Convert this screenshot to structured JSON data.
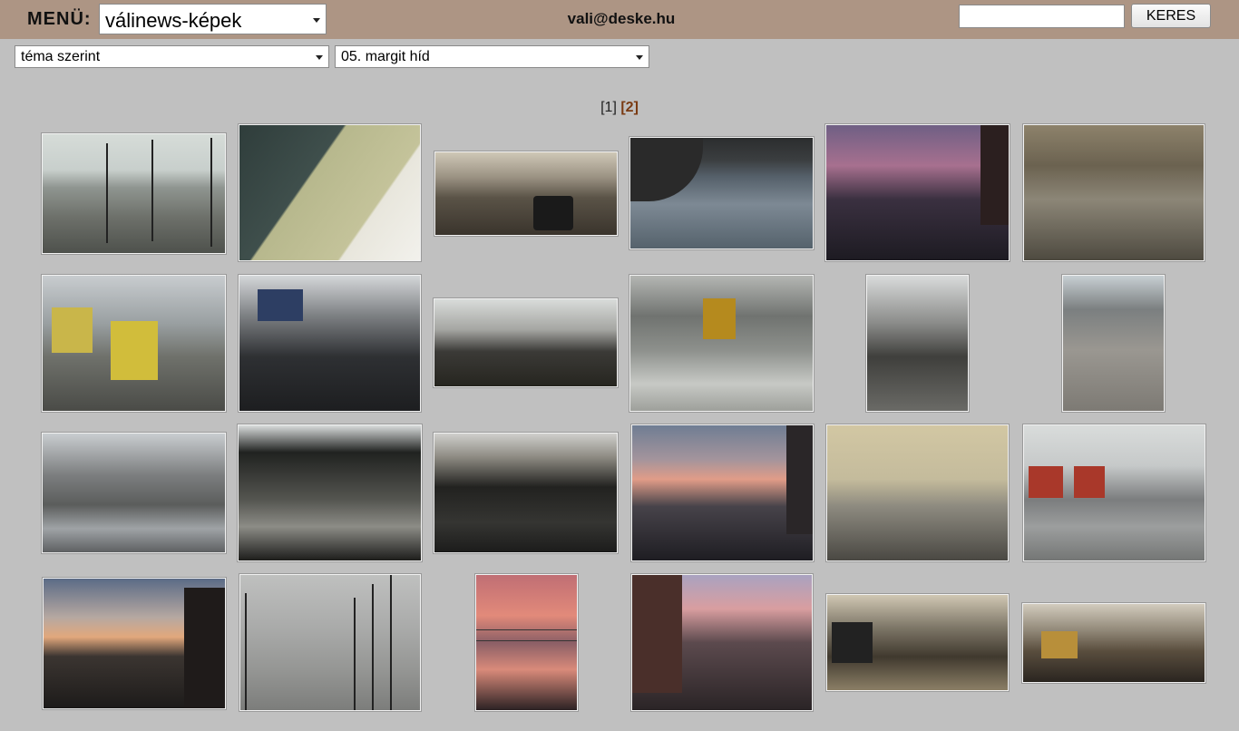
{
  "header": {
    "menu_label": "MENÜ:",
    "menu_select": "válinews-képek",
    "email": "vali@deske.hu",
    "search_placeholder": "",
    "search_button": "KERES"
  },
  "filters": {
    "category": "téma szerint",
    "topic": "05. margit híd"
  },
  "pagination": {
    "pages": [
      "[1]",
      "[2]"
    ],
    "current": "[2]"
  }
}
